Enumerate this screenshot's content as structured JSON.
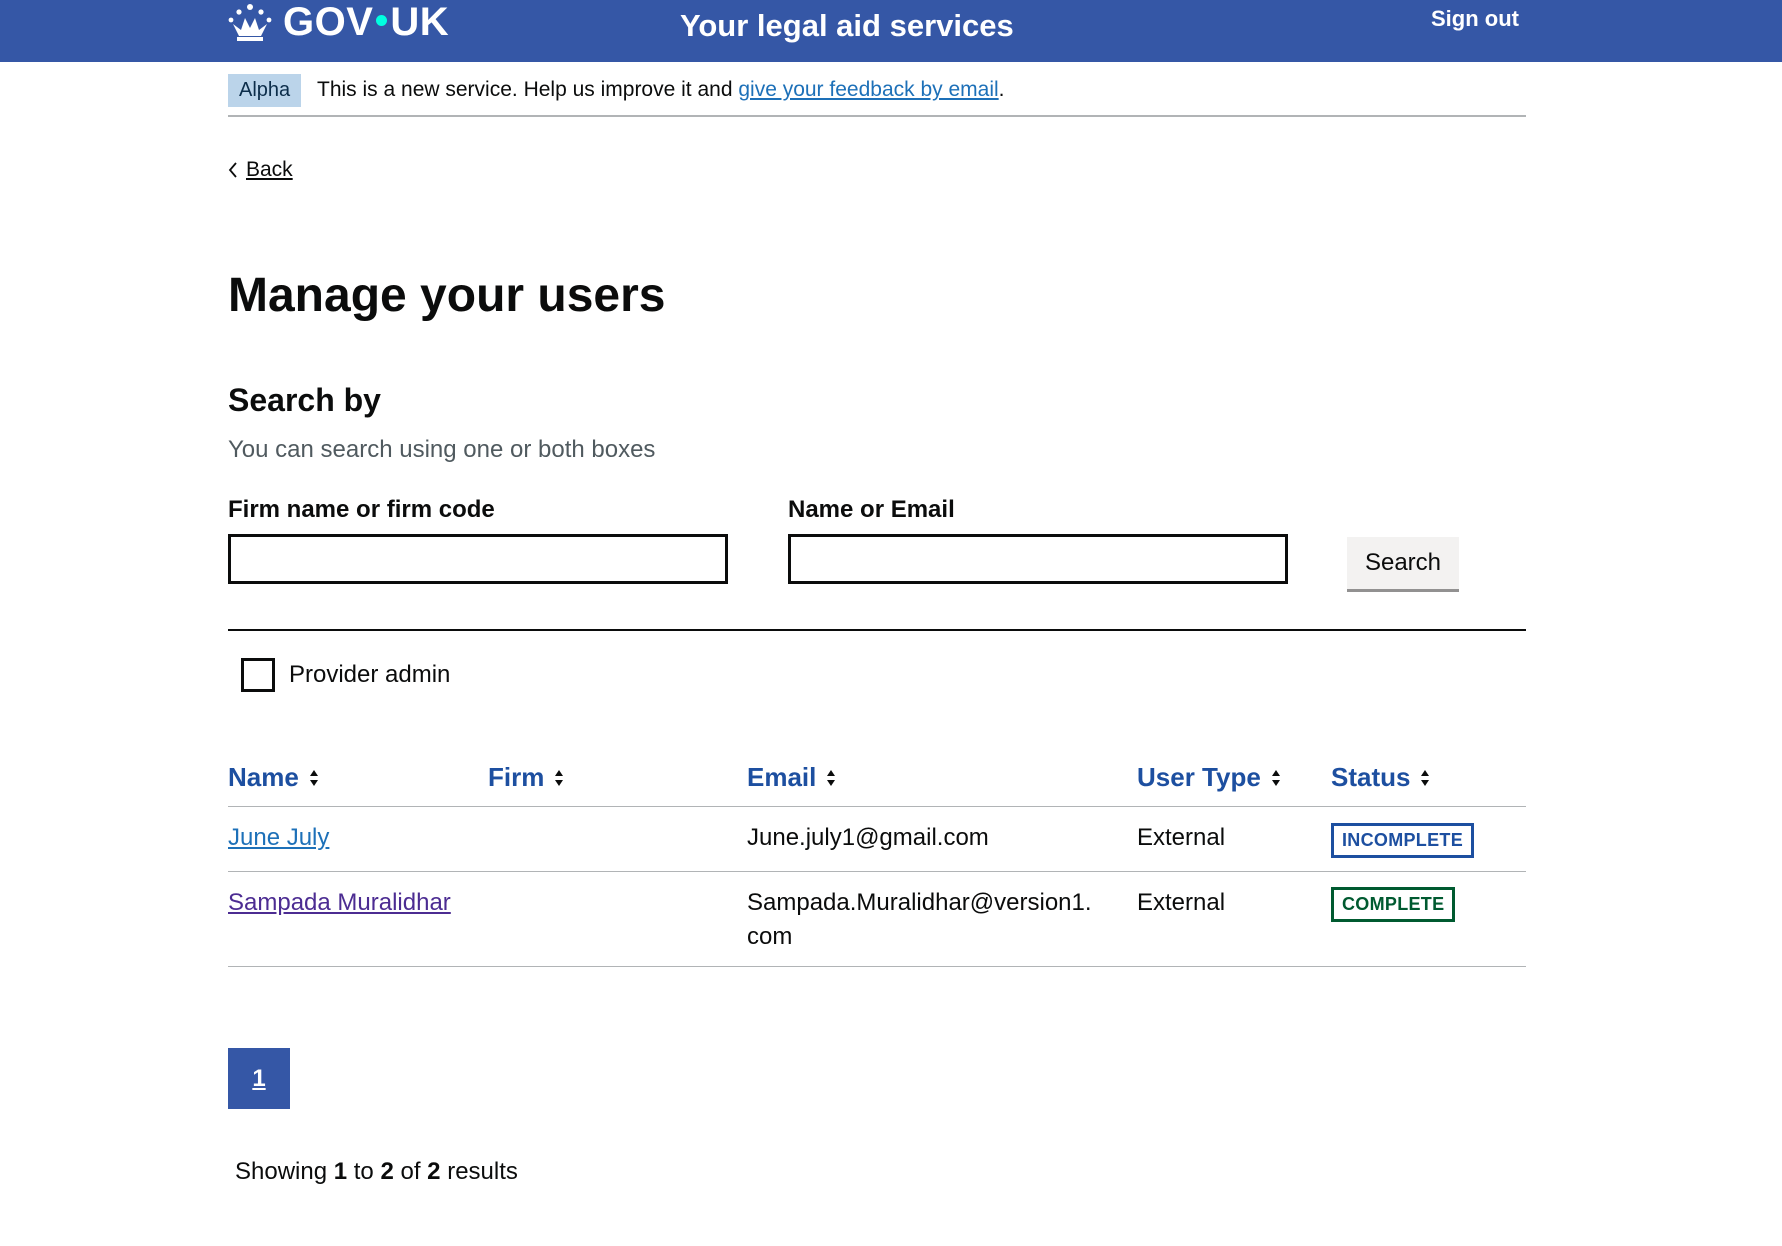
{
  "header": {
    "logo_text_left": "GOV",
    "logo_text_right": "UK",
    "service_name": "Your legal aid services",
    "sign_out": "Sign out"
  },
  "phase_banner": {
    "tag": "Alpha",
    "text": "This is a new service. Help us improve it and",
    "link": "give your feedback by email",
    "suffix": "."
  },
  "back_link": "Back",
  "page_title": "Manage your users",
  "search": {
    "heading": "Search by",
    "hint": "You can search using one or both boxes",
    "firm_label": "Firm name or firm code",
    "firm_value": "",
    "name_label": "Name or Email",
    "name_value": "",
    "button": "Search"
  },
  "filter": {
    "provider_admin_label": "Provider admin",
    "provider_admin_checked": false
  },
  "table": {
    "headers": [
      "Name",
      "Firm",
      "Email",
      "User Type",
      "Status"
    ],
    "rows": [
      {
        "name": "June July",
        "firm": "",
        "email": "June.july1@gmail.com",
        "user_type": "External",
        "status": "INCOMPLETE"
      },
      {
        "name": "Sampada Muralidhar",
        "firm": "",
        "email_line1": "Sampada.Muralidhar@version1.",
        "email_line2": "com",
        "user_type": "External",
        "status": "COMPLETE"
      }
    ]
  },
  "pagination": {
    "current_page": "1"
  },
  "results": {
    "prefix": "Showing",
    "from": "1",
    "to_word": "to",
    "to": "2",
    "of_word": "of",
    "total": "2",
    "suffix": "results"
  },
  "colors": {
    "header_bg": "#3557a6",
    "link": "#1d70b8",
    "tag_incomplete": "#1d4fa0",
    "tag_complete": "#005a30"
  }
}
